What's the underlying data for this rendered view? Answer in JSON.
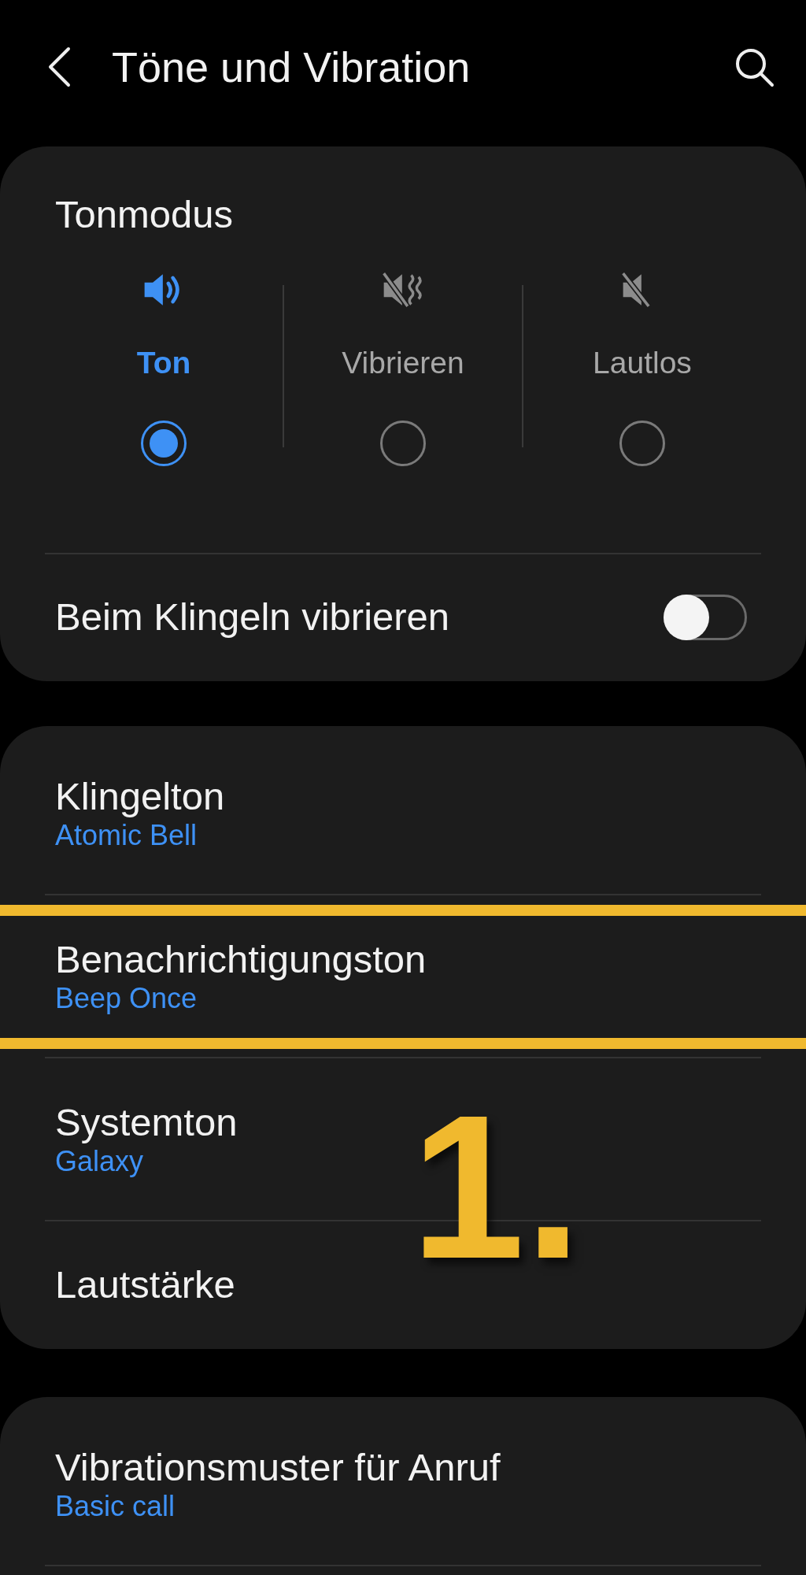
{
  "header": {
    "title": "Töne und Vibration"
  },
  "sound_mode": {
    "title": "Tonmodus",
    "options": [
      {
        "label": "Ton",
        "kind": "sound",
        "selected": true
      },
      {
        "label": "Vibrieren",
        "kind": "vibrate",
        "selected": false
      },
      {
        "label": "Lautlos",
        "kind": "mute",
        "selected": false
      }
    ]
  },
  "vibrate_on_ring": {
    "label": "Beim Klingeln vibrieren",
    "on": false
  },
  "settings": [
    {
      "title": "Klingelton",
      "value": "Atomic Bell",
      "highlighted": false
    },
    {
      "title": "Benachrichtigungston",
      "value": "Beep Once",
      "highlighted": true
    },
    {
      "title": "Systemton",
      "value": "Galaxy",
      "highlighted": false
    },
    {
      "title": "Lautstärke",
      "highlighted": false
    }
  ],
  "more_settings": [
    {
      "title": "Vibrationsmuster für Anruf",
      "value": "Basic call"
    }
  ],
  "annotation": {
    "step": "1."
  }
}
